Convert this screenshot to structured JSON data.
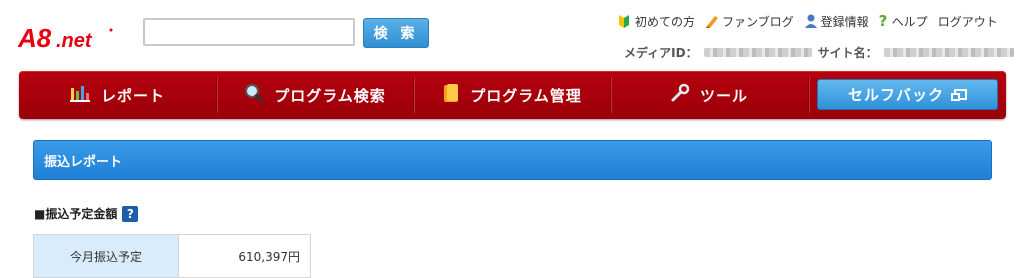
{
  "header": {
    "logo_text": "A8.net",
    "search": {
      "value": "",
      "placeholder": "",
      "button_label": "検 索"
    },
    "links": [
      {
        "label": "初めての方",
        "icon": "beginner-leaf-icon"
      },
      {
        "label": "ファンブログ",
        "icon": "pencil-icon"
      },
      {
        "label": "登録情報",
        "icon": "person-icon"
      },
      {
        "label": "ヘルプ",
        "icon": "question-icon"
      },
      {
        "label": "ログアウト",
        "icon": ""
      }
    ],
    "media_id_label": "メディアID：",
    "site_name_label": "サイト名："
  },
  "nav": {
    "items": [
      {
        "label": "レポート",
        "icon": "bar-chart-icon"
      },
      {
        "label": "プログラム検索",
        "icon": "magnifier-icon"
      },
      {
        "label": "プログラム管理",
        "icon": "folder-icon"
      },
      {
        "label": "ツール",
        "icon": "wrench-icon"
      }
    ],
    "selfback_label": "セルフバック"
  },
  "section": {
    "title": "振込レポート",
    "subheading": "■振込予定金額",
    "help_label": "?",
    "table": {
      "label": "今月振込予定",
      "value": "610,397円"
    }
  },
  "colors": {
    "nav_red": "#a6000b",
    "accent_blue": "#2f8fd1",
    "logo_red": "#e60012"
  }
}
